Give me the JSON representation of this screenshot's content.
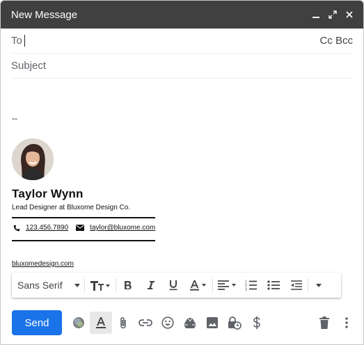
{
  "window": {
    "title": "New Message"
  },
  "header": {
    "to_label": "To",
    "cc_label": "Cc",
    "bcc_label": "Bcc",
    "subject_placeholder": "Subject"
  },
  "signature": {
    "separator": "--",
    "name": "Taylor Wynn",
    "role": "Lead Designer at Bluxome Design Co.",
    "phone": "123.456.7890",
    "email": "taylor@bluxome.com",
    "website": "bluxomedesign.com"
  },
  "format_toolbar": {
    "font_family": "Sans Serif",
    "icons": [
      "text-size-icon",
      "bold-icon",
      "italic-icon",
      "underline-icon",
      "text-color-icon",
      "align-icon",
      "numbered-list-icon",
      "bulleted-list-icon",
      "indent-less-icon",
      "more-formatting-icon"
    ]
  },
  "bottom_toolbar": {
    "send_label": "Send",
    "icons": [
      "formatting-options-icon",
      "attach-icon",
      "link-icon",
      "emoji-icon",
      "drive-icon",
      "photo-icon",
      "confidential-mode-icon",
      "money-icon",
      "discard-icon",
      "more-options-icon"
    ]
  },
  "colors": {
    "titlebar": "#404040",
    "send_button": "#1a73e8",
    "icon": "#5f6368"
  }
}
